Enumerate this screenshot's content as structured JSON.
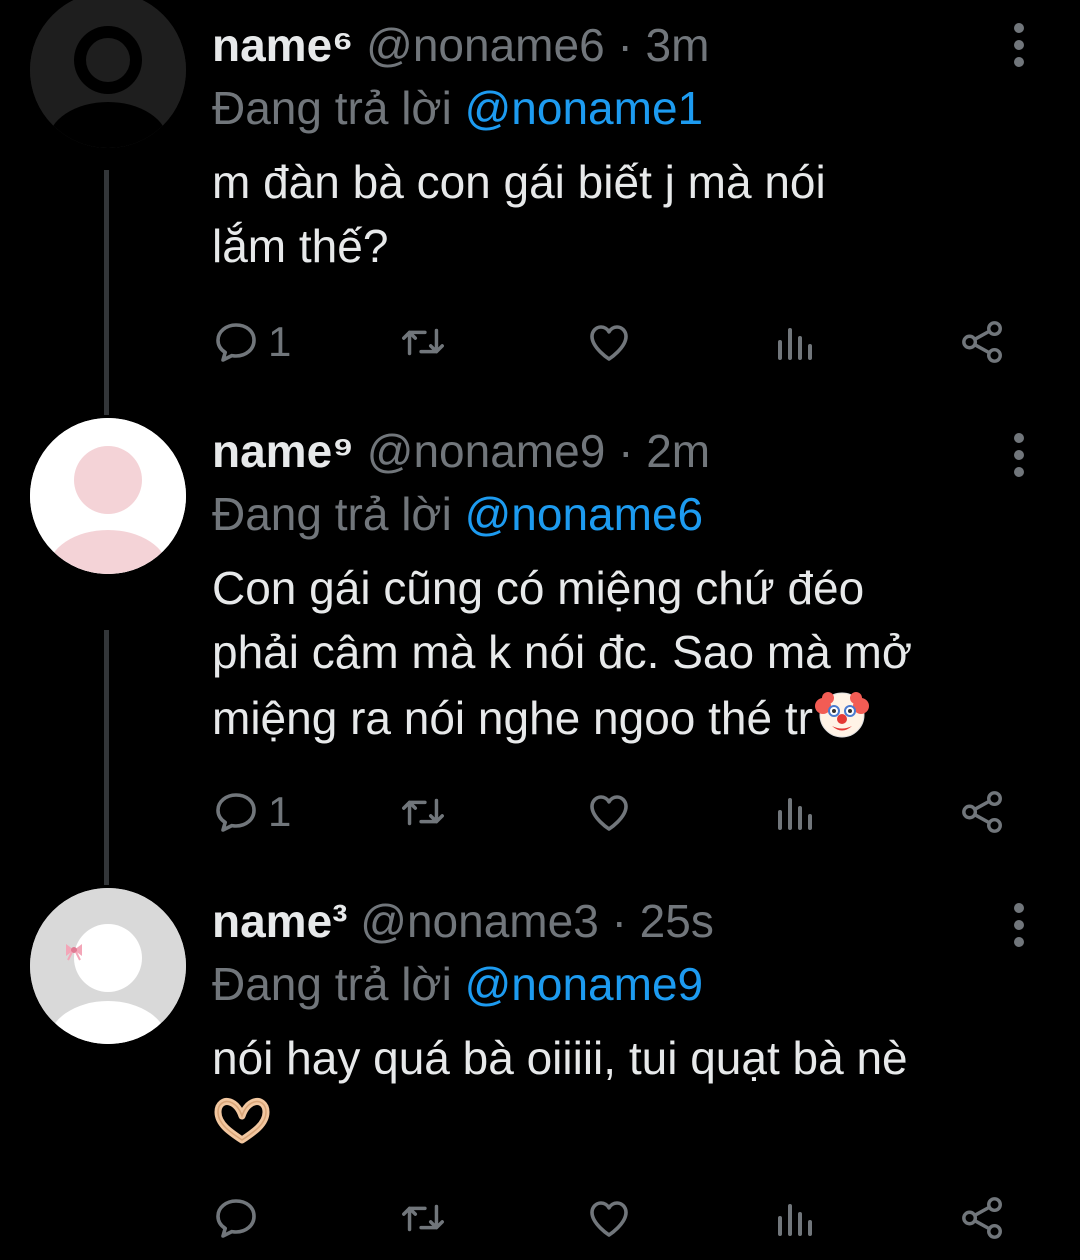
{
  "tweets": [
    {
      "display_name": "name⁶",
      "handle": "@noname6",
      "time": "3m",
      "replying_prefix": "Đang trả lời",
      "replying_to": "@noname1",
      "text": "m đàn bà con gái biết j mà nói\nlắm thế?",
      "emoji": "",
      "reply_count": "1",
      "avatar": {
        "background": "#1e1e1e",
        "figure": "#000000"
      }
    },
    {
      "display_name": "name⁹",
      "handle": "@noname9",
      "time": "2m",
      "replying_prefix": "Đang trả lời",
      "replying_to": "@noname6",
      "text": "Con gái cũng có miệng chứ đéo\nphải câm mà k nói đc. Sao mà mở\nmiệng ra nói nghe ngoo thé tr",
      "emoji": "clown-face-emoji",
      "reply_count": "1",
      "avatar": {
        "background": "#ffffff",
        "figure": "#f4d3d7"
      }
    },
    {
      "display_name": "name³",
      "handle": "@noname3",
      "time": "25s",
      "replying_prefix": "Đang trả lời",
      "replying_to": "@noname9",
      "text": "nói hay quá bà oiiiii, tui quạt bà nè\n",
      "emoji": "heart-hands-emoji",
      "reply_count": "",
      "avatar": {
        "background": "#d9d9d9",
        "figure": "#ffffff"
      }
    }
  ],
  "icons": [
    "reply-icon",
    "retweet-icon",
    "like-icon",
    "views-icon",
    "share-icon",
    "more-icon"
  ],
  "colors": {
    "background": "#000000",
    "text": "#e7e9ea",
    "secondary": "#71767b",
    "link": "#1d9bf0",
    "thread_line": "#333639"
  }
}
